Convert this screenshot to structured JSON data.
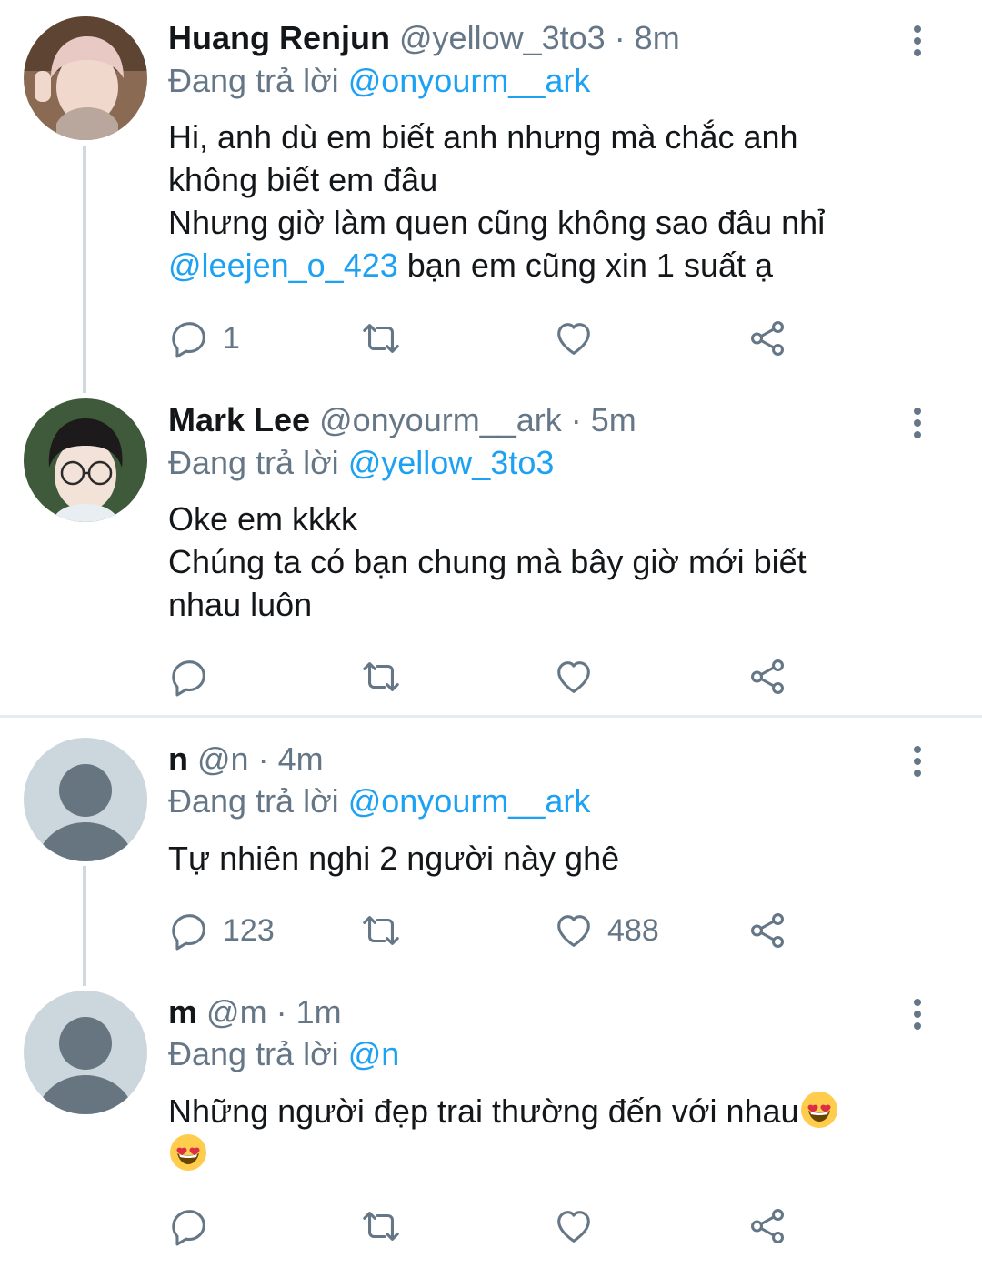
{
  "tweets": [
    {
      "name": "Huang Renjun",
      "handle": "@yellow_3to3",
      "time": "· 8m",
      "replying_prefix": "Đang trả lời",
      "replying_to": "@onyourm__ark",
      "text_lines": [
        "Hi, anh dù em biết anh nhưng mà chắc anh",
        "không biết em đâu",
        "Nhưng giờ làm quen cũng không sao đâu nhỉ"
      ],
      "mention": "@leejen_o_423",
      "mention_rest": " bạn em cũng xin 1 suất ạ",
      "reply_count": "1",
      "retweet_count": "",
      "like_count": ""
    },
    {
      "name": "Mark Lee",
      "handle": "@onyourm__ark",
      "time": "· 5m",
      "replying_prefix": "Đang trả lời",
      "replying_to": "@yellow_3to3",
      "text_lines": [
        "Oke em kkkk",
        "Chúng ta có bạn chung mà bây giờ mới biết",
        "nhau luôn"
      ],
      "reply_count": "",
      "retweet_count": "",
      "like_count": ""
    },
    {
      "name": "n",
      "handle": "@n",
      "time": "· 4m",
      "replying_prefix": "Đang trả lời",
      "replying_to": "@onyourm__ark",
      "text_lines": [
        "Tự nhiên nghi 2 người này ghê"
      ],
      "reply_count": "123",
      "retweet_count": "",
      "like_count": "488"
    },
    {
      "name": "m",
      "handle": "@m",
      "time": "· 1m",
      "replying_prefix": "Đang trả lời",
      "replying_to": "@n",
      "text_lines": [
        "Những người đẹp trai thường đến với nhau"
      ],
      "emoji": "heart-eyes",
      "reply_count": "",
      "retweet_count": "",
      "like_count": ""
    }
  ],
  "colors": {
    "link": "#1da1f2",
    "secondary_text": "#657786",
    "primary_text": "#14171a",
    "thread_line": "#cfd9de",
    "divider": "#e6ecf0",
    "default_avatar_bg": "#ccd6dd",
    "default_avatar_fg": "#66757f"
  },
  "icons": [
    "reply-icon",
    "retweet-icon",
    "like-icon",
    "share-icon",
    "more-options-icon"
  ]
}
